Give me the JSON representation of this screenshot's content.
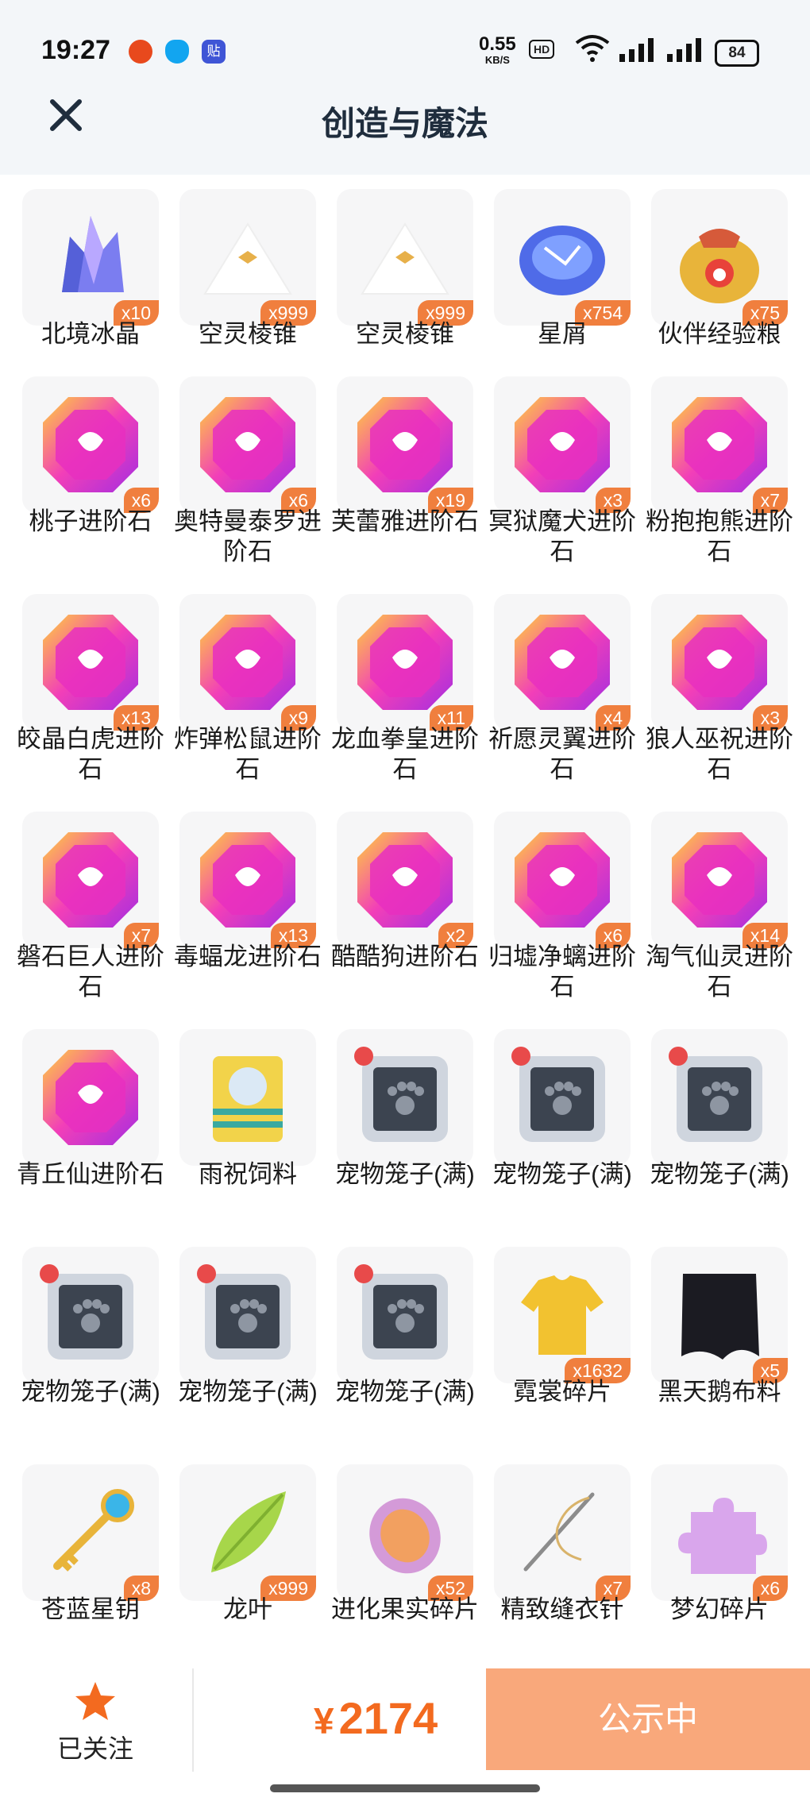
{
  "status_bar": {
    "time": "19:27",
    "speed_value": "0.55",
    "speed_unit": "KB/S",
    "hd_label": "HD",
    "battery": "84",
    "icons": [
      "app-icon-1",
      "qq-icon",
      "tieba-icon",
      "hd-icon",
      "wifi-icon",
      "signal-icon",
      "battery-icon"
    ]
  },
  "header": {
    "title": "创造与魔法",
    "close_icon": "close-icon"
  },
  "items": [
    {
      "name": "北境冰晶",
      "count": "x10",
      "icon": "crystal-icon"
    },
    {
      "name": "空灵棱锥",
      "count": "x999",
      "icon": "pyramid-icon"
    },
    {
      "name": "空灵棱锥",
      "count": "x999",
      "icon": "pyramid-icon"
    },
    {
      "name": "星屑",
      "count": "x754",
      "icon": "stardust-icon"
    },
    {
      "name": "伙伴经验粮",
      "count": "x75",
      "icon": "food-bag-icon"
    },
    {
      "name": "桃子进阶石",
      "count": "x6",
      "icon": "gem-icon"
    },
    {
      "name": "奥特曼泰罗进阶石",
      "count": "x6",
      "icon": "gem-icon"
    },
    {
      "name": "芙蕾雅进阶石",
      "count": "x19",
      "icon": "gem-icon"
    },
    {
      "name": "冥狱魔犬进阶石",
      "count": "x3",
      "icon": "gem-icon"
    },
    {
      "name": "粉抱抱熊进阶石",
      "count": "x7",
      "icon": "gem-icon"
    },
    {
      "name": "皎晶白虎进阶石",
      "count": "x13",
      "icon": "gem-icon"
    },
    {
      "name": "炸弹松鼠进阶石",
      "count": "x9",
      "icon": "gem-icon"
    },
    {
      "name": "龙血拳皇进阶石",
      "count": "x11",
      "icon": "gem-icon"
    },
    {
      "name": "祈愿灵翼进阶石",
      "count": "x4",
      "icon": "gem-icon"
    },
    {
      "name": "狼人巫祝进阶石",
      "count": "x3",
      "icon": "gem-icon"
    },
    {
      "name": "磐石巨人进阶石",
      "count": "x7",
      "icon": "gem-icon"
    },
    {
      "name": "毒蝠龙进阶石",
      "count": "x13",
      "icon": "gem-icon"
    },
    {
      "name": "酷酷狗进阶石",
      "count": "x2",
      "icon": "gem-icon"
    },
    {
      "name": "归墟净螭进阶石",
      "count": "x6",
      "icon": "gem-icon"
    },
    {
      "name": "淘气仙灵进阶石",
      "count": "x14",
      "icon": "gem-icon"
    },
    {
      "name": "青丘仙进阶石",
      "count": "",
      "icon": "gem-icon"
    },
    {
      "name": "雨祝饲料",
      "count": "",
      "icon": "feed-bag-icon"
    },
    {
      "name": "宠物笼子(满)",
      "count": "",
      "icon": "pet-cage-icon"
    },
    {
      "name": "宠物笼子(满)",
      "count": "",
      "icon": "pet-cage-icon"
    },
    {
      "name": "宠物笼子(满)",
      "count": "",
      "icon": "pet-cage-icon"
    },
    {
      "name": "宠物笼子(满)",
      "count": "",
      "icon": "pet-cage-icon"
    },
    {
      "name": "宠物笼子(满)",
      "count": "",
      "icon": "pet-cage-icon"
    },
    {
      "name": "宠物笼子(满)",
      "count": "",
      "icon": "pet-cage-icon"
    },
    {
      "name": "霓裳碎片",
      "count": "x1632",
      "icon": "shirt-icon"
    },
    {
      "name": "黑天鹅布料",
      "count": "x5",
      "icon": "cloth-icon"
    },
    {
      "name": "苍蓝星钥",
      "count": "x8",
      "icon": "key-icon"
    },
    {
      "name": "龙叶",
      "count": "x999",
      "icon": "leaf-icon"
    },
    {
      "name": "进化果实碎片",
      "count": "x52",
      "icon": "fruit-slice-icon"
    },
    {
      "name": "精致缝衣针",
      "count": "x7",
      "icon": "needle-icon"
    },
    {
      "name": "梦幻碎片",
      "count": "x6",
      "icon": "puzzle-icon"
    }
  ],
  "bottom_bar": {
    "follow_label": "已关注",
    "follow_icon": "star-icon",
    "currency": "¥",
    "price": "2174",
    "status_button": "公示中"
  },
  "colors": {
    "accent": "#f36a1f",
    "badge": "#f07f3e",
    "status_button_bg": "#f9a87b",
    "header_bg": "#f3f6f9"
  }
}
